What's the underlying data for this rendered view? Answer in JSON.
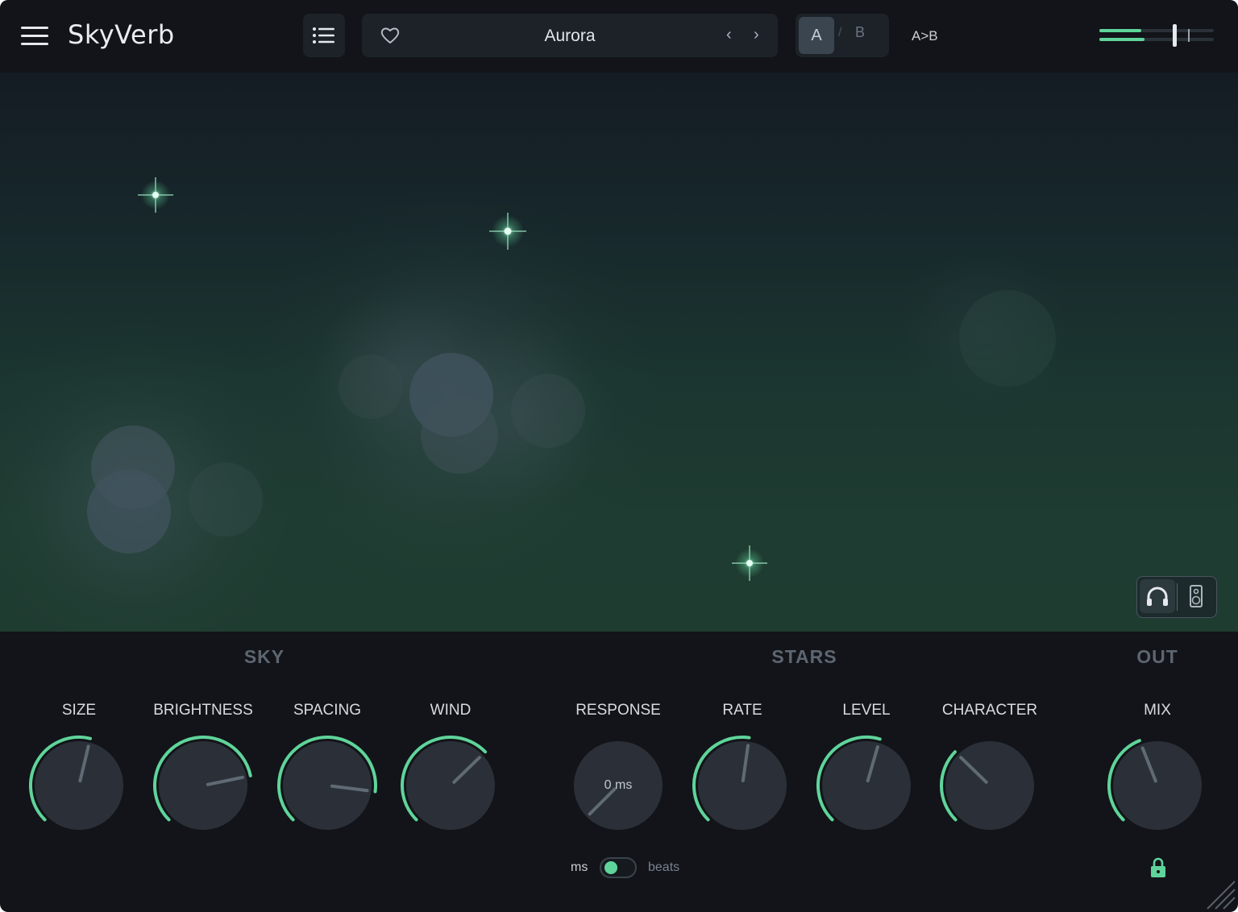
{
  "header": {
    "app_title": "SkyVerb",
    "preset_name": "Aurora",
    "prev_symbol": "‹",
    "next_symbol": "›",
    "ab_a": "A",
    "ab_separator": "/",
    "ab_b": "B",
    "copy_a_to_b": "A>B",
    "icons": {
      "menu": "hamburger-menu-icon",
      "preset_list": "list-icon",
      "favorite": "heart-icon",
      "output_meter": "level-meter-icon"
    }
  },
  "monitor": {
    "headphones_icon": "headphones-icon",
    "speaker_icon": "speaker-icon",
    "selected": "headphones"
  },
  "sections": {
    "sky": "SKY",
    "stars": "STARS",
    "out": "OUT"
  },
  "knobs": [
    {
      "id": "size",
      "label": "SIZE",
      "value": 0.55
    },
    {
      "id": "brightness",
      "label": "BRIGHTNESS",
      "value": 0.79
    },
    {
      "id": "spacing",
      "label": "SPACING",
      "value": 0.86
    },
    {
      "id": "wind",
      "label": "WIND",
      "value": 0.67
    },
    {
      "id": "response",
      "label": "RESPONSE",
      "value": 0.0,
      "value_text": "0 ms"
    },
    {
      "id": "rate",
      "label": "RATE",
      "value": 0.53
    },
    {
      "id": "level",
      "label": "LEVEL",
      "value": 0.56
    },
    {
      "id": "character",
      "label": "CHARACTER",
      "value": 0.33
    },
    {
      "id": "mix",
      "label": "MIX",
      "value": 0.42
    }
  ],
  "response_unit": {
    "left": "ms",
    "right": "beats",
    "selected": "ms"
  },
  "mix_lock_icon": "lock-icon",
  "colors": {
    "accent": "#5fd49a",
    "background": "#121419",
    "knob_body": "#2b3038",
    "pointer": "#5f6a74"
  }
}
